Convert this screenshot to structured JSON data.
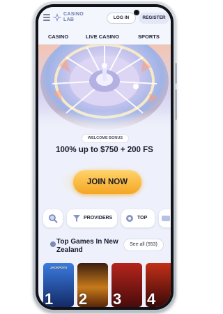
{
  "header": {
    "logo_line1": "CASINO",
    "logo_line2": "LAB",
    "login_label": "LOG IN",
    "register_label": "REGISTER"
  },
  "nav": {
    "items": [
      {
        "label": "CASINO"
      },
      {
        "label": "LIVE CASINO"
      },
      {
        "label": "SPORTS"
      }
    ]
  },
  "promo": {
    "badge": "WELCOME BONUS",
    "offer": "100% up to $750 + 200 FS",
    "cta_label": "JOIN NOW"
  },
  "filters": {
    "providers_label": "PROVIDERS",
    "top_label": "TOP"
  },
  "games": {
    "title": "Top Games In New Zealand",
    "see_all_label": "See all (553)",
    "tiles": [
      {
        "rank": "1",
        "name": "JACKPOTS",
        "color": "#2a5fb8"
      },
      {
        "rank": "2",
        "name": "",
        "color": "#8a3b10"
      },
      {
        "rank": "3",
        "name": "",
        "color": "#9b1d1d"
      },
      {
        "rank": "4",
        "name": "",
        "color": "#7a1a14"
      }
    ]
  },
  "icons": [
    "menu-icon",
    "casino-lab-logo-icon",
    "search-icon",
    "providers-icon",
    "top-icon",
    "games-section-icon"
  ],
  "colors": {
    "accent_button": "#f5a623",
    "screen_bg": "#eef1fb",
    "text_dark": "#15192c"
  }
}
